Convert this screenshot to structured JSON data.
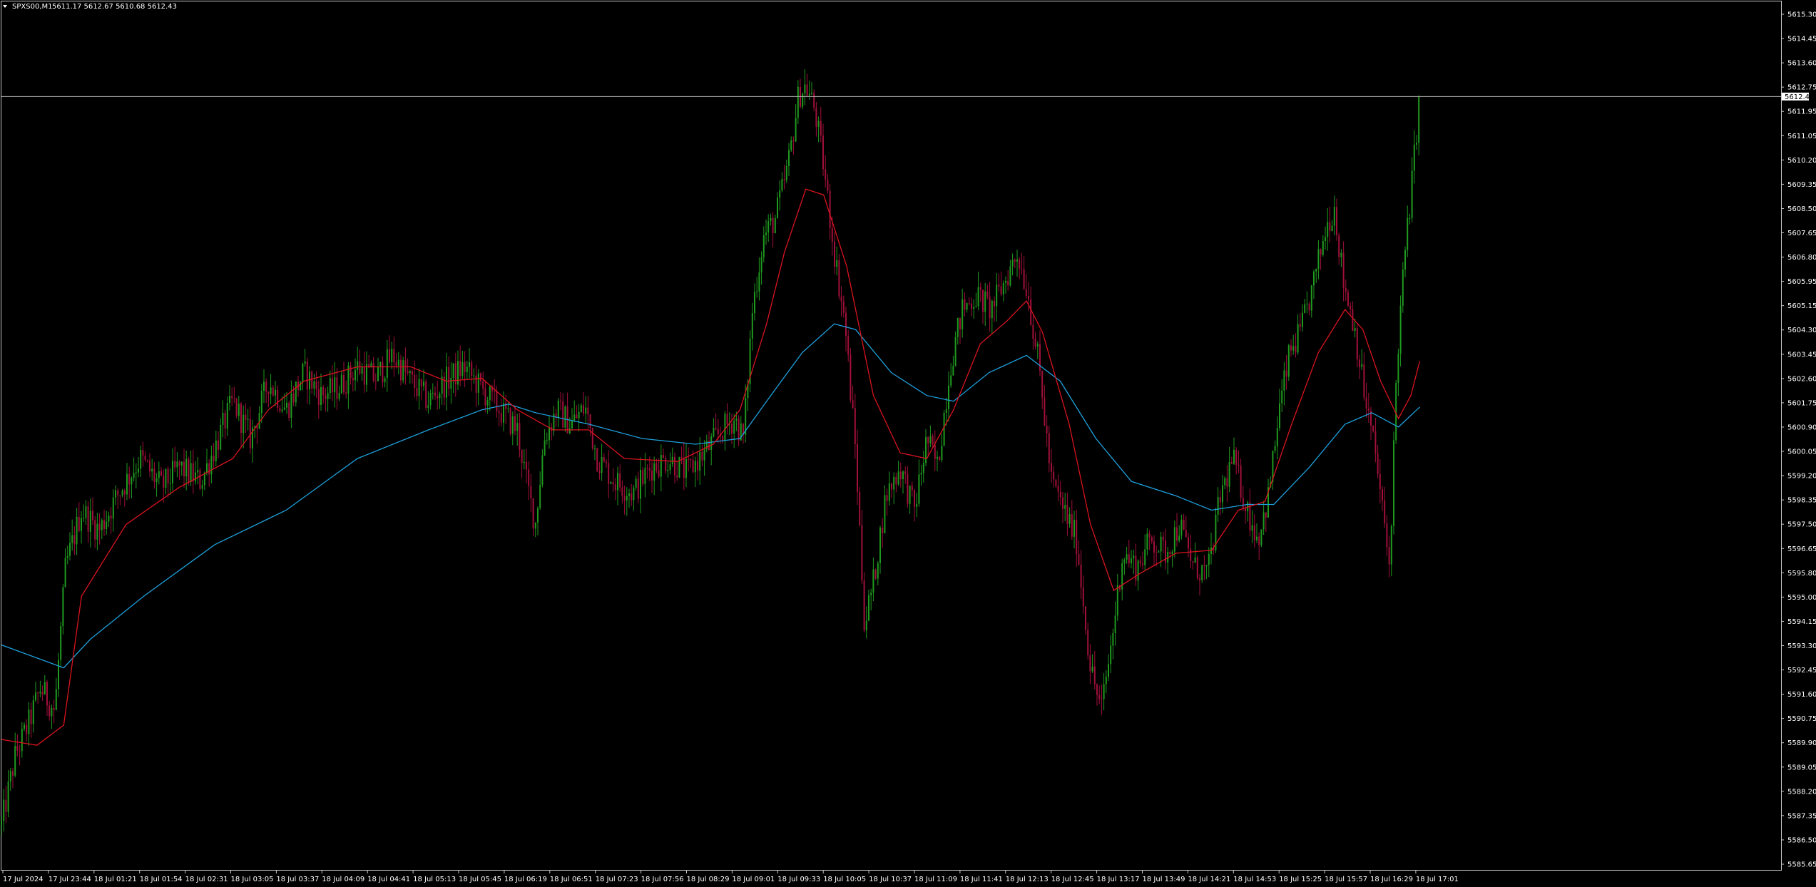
{
  "header": {
    "symbol": "SPXS00,M1",
    "ohlc": "5611.17 5612.67 5610.68 5612.43"
  },
  "price_tag": "5612.43",
  "colors": {
    "background": "#000000",
    "frame": "#c8c8c8",
    "bull": "#1f9a1f",
    "bear": "#a0103a",
    "ma_fast": "#d9141e",
    "ma_slow": "#1ea0dc",
    "last_price_line": "#b4b4b4"
  },
  "chart_data": {
    "type": "candlestick",
    "grid": false,
    "ylim": [
      5585.65,
      5615.3
    ],
    "y_ticks": [
      "5615.30",
      "5614.45",
      "5613.60",
      "5612.75",
      "5611.95",
      "5611.05",
      "5610.20",
      "5609.35",
      "5608.50",
      "5607.65",
      "5606.80",
      "5605.95",
      "5605.15",
      "5604.30",
      "5603.45",
      "5602.60",
      "5601.75",
      "5600.90",
      "5600.05",
      "5599.20",
      "5598.35",
      "5597.50",
      "5596.65",
      "5595.80",
      "5595.00",
      "5594.15",
      "5593.30",
      "5592.45",
      "5591.60",
      "5590.75",
      "5589.90",
      "5589.05",
      "5588.20",
      "5587.35",
      "5586.50",
      "5585.65"
    ],
    "x_ticks": [
      "17 Jul 2024",
      "17 Jul 23:44",
      "18 Jul 01:21",
      "18 Jul 01:54",
      "18 Jul 02:31",
      "18 Jul 03:05",
      "18 Jul 03:37",
      "18 Jul 04:09",
      "18 Jul 04:41",
      "18 Jul 05:13",
      "18 Jul 05:45",
      "18 Jul 06:19",
      "18 Jul 06:51",
      "18 Jul 07:23",
      "18 Jul 07:56",
      "18 Jul 08:29",
      "18 Jul 09:01",
      "18 Jul 09:33",
      "18 Jul 10:05",
      "18 Jul 10:37",
      "18 Jul 11:09",
      "18 Jul 11:41",
      "18 Jul 12:13",
      "18 Jul 12:45",
      "18 Jul 13:17",
      "18 Jul 13:49",
      "18 Jul 14:21",
      "18 Jul 14:53",
      "18 Jul 15:25",
      "18 Jul 15:57",
      "18 Jul 16:29",
      "18 Jul 17:01"
    ],
    "last_price": 5612.43,
    "close_path": [
      [
        0,
        5587.0
      ],
      [
        0.008,
        5589.5
      ],
      [
        0.015,
        5590.5
      ],
      [
        0.022,
        5591.8
      ],
      [
        0.03,
        5591.0
      ],
      [
        0.036,
        5596.0
      ],
      [
        0.045,
        5598.0
      ],
      [
        0.055,
        5597.3
      ],
      [
        0.065,
        5598.5
      ],
      [
        0.078,
        5599.8
      ],
      [
        0.09,
        5598.8
      ],
      [
        0.1,
        5599.5
      ],
      [
        0.112,
        5599.0
      ],
      [
        0.12,
        5600.2
      ],
      [
        0.13,
        5601.8
      ],
      [
        0.14,
        5600.5
      ],
      [
        0.15,
        5602.5
      ],
      [
        0.16,
        5601.5
      ],
      [
        0.17,
        5602.8
      ],
      [
        0.18,
        5602.0
      ],
      [
        0.19,
        5602.3
      ],
      [
        0.2,
        5603.0
      ],
      [
        0.21,
        5602.6
      ],
      [
        0.22,
        5603.4
      ],
      [
        0.23,
        5602.5
      ],
      [
        0.24,
        5601.8
      ],
      [
        0.25,
        5602.5
      ],
      [
        0.26,
        5603.0
      ],
      [
        0.27,
        5602.2
      ],
      [
        0.28,
        5601.5
      ],
      [
        0.29,
        5600.8
      ],
      [
        0.295,
        5599.0
      ],
      [
        0.3,
        5597.5
      ],
      [
        0.305,
        5600.5
      ],
      [
        0.312,
        5601.5
      ],
      [
        0.32,
        5601.0
      ],
      [
        0.328,
        5601.6
      ],
      [
        0.335,
        5599.8
      ],
      [
        0.345,
        5599.0
      ],
      [
        0.355,
        5598.6
      ],
      [
        0.365,
        5599.5
      ],
      [
        0.375,
        5599.8
      ],
      [
        0.385,
        5599.3
      ],
      [
        0.395,
        5600.0
      ],
      [
        0.405,
        5600.8
      ],
      [
        0.412,
        5601.2
      ],
      [
        0.417,
        5600.5
      ],
      [
        0.422,
        5605.0
      ],
      [
        0.428,
        5607.5
      ],
      [
        0.435,
        5608.2
      ],
      [
        0.442,
        5610.0
      ],
      [
        0.448,
        5612.5
      ],
      [
        0.452,
        5612.8
      ],
      [
        0.457,
        5612.0
      ],
      [
        0.462,
        5610.0
      ],
      [
        0.468,
        5607.0
      ],
      [
        0.474,
        5604.5
      ],
      [
        0.48,
        5600.0
      ],
      [
        0.485,
        5594.0
      ],
      [
        0.49,
        5595.5
      ],
      [
        0.497,
        5598.5
      ],
      [
        0.505,
        5599.5
      ],
      [
        0.513,
        5598.0
      ],
      [
        0.52,
        5600.5
      ],
      [
        0.526,
        5599.5
      ],
      [
        0.533,
        5603.0
      ],
      [
        0.54,
        5605.0
      ],
      [
        0.548,
        5605.5
      ],
      [
        0.556,
        5605.0
      ],
      [
        0.564,
        5606.0
      ],
      [
        0.571,
        5607.0
      ],
      [
        0.577,
        5605.5
      ],
      [
        0.583,
        5603.0
      ],
      [
        0.59,
        5599.0
      ],
      [
        0.597,
        5598.0
      ],
      [
        0.604,
        5597.0
      ],
      [
        0.612,
        5592.5
      ],
      [
        0.618,
        5591.0
      ],
      [
        0.624,
        5593.5
      ],
      [
        0.63,
        5596.5
      ],
      [
        0.638,
        5596.0
      ],
      [
        0.646,
        5597.0
      ],
      [
        0.654,
        5596.5
      ],
      [
        0.662,
        5597.5
      ],
      [
        0.67,
        5596.0
      ],
      [
        0.678,
        5595.8
      ],
      [
        0.685,
        5598.5
      ],
      [
        0.692,
        5599.8
      ],
      [
        0.7,
        5598.0
      ],
      [
        0.706,
        5597.0
      ],
      [
        0.712,
        5598.5
      ],
      [
        0.718,
        5601.5
      ],
      [
        0.724,
        5603.5
      ],
      [
        0.73,
        5604.2
      ],
      [
        0.737,
        5605.8
      ],
      [
        0.744,
        5607.8
      ],
      [
        0.749,
        5608.6
      ],
      [
        0.754,
        5606.0
      ],
      [
        0.76,
        5604.5
      ],
      [
        0.766,
        5602.0
      ],
      [
        0.772,
        5600.0
      ],
      [
        0.776,
        5598.0
      ],
      [
        0.78,
        5596.0
      ],
      [
        0.784,
        5603.0
      ],
      [
        0.788,
        5606.5
      ],
      [
        0.792,
        5609.0
      ],
      [
        0.797,
        5612.6
      ]
    ],
    "ma_fast": [
      [
        0,
        5590.0
      ],
      [
        0.02,
        5589.8
      ],
      [
        0.035,
        5590.5
      ],
      [
        0.045,
        5595.0
      ],
      [
        0.07,
        5597.5
      ],
      [
        0.1,
        5598.8
      ],
      [
        0.13,
        5599.8
      ],
      [
        0.15,
        5601.5
      ],
      [
        0.17,
        5602.5
      ],
      [
        0.2,
        5603.0
      ],
      [
        0.23,
        5603.0
      ],
      [
        0.25,
        5602.5
      ],
      [
        0.27,
        5602.6
      ],
      [
        0.29,
        5601.5
      ],
      [
        0.31,
        5600.8
      ],
      [
        0.33,
        5600.8
      ],
      [
        0.35,
        5599.8
      ],
      [
        0.38,
        5599.7
      ],
      [
        0.4,
        5600.3
      ],
      [
        0.415,
        5601.5
      ],
      [
        0.43,
        5604.5
      ],
      [
        0.44,
        5607.0
      ],
      [
        0.452,
        5609.2
      ],
      [
        0.462,
        5609.0
      ],
      [
        0.475,
        5606.5
      ],
      [
        0.49,
        5602.0
      ],
      [
        0.505,
        5600.0
      ],
      [
        0.52,
        5599.8
      ],
      [
        0.535,
        5601.5
      ],
      [
        0.55,
        5603.8
      ],
      [
        0.565,
        5604.6
      ],
      [
        0.576,
        5605.3
      ],
      [
        0.585,
        5604.2
      ],
      [
        0.6,
        5601.0
      ],
      [
        0.612,
        5597.5
      ],
      [
        0.625,
        5595.2
      ],
      [
        0.64,
        5595.8
      ],
      [
        0.66,
        5596.5
      ],
      [
        0.68,
        5596.6
      ],
      [
        0.695,
        5598.0
      ],
      [
        0.71,
        5598.3
      ],
      [
        0.725,
        5601.0
      ],
      [
        0.74,
        5603.5
      ],
      [
        0.755,
        5605.0
      ],
      [
        0.765,
        5604.3
      ],
      [
        0.775,
        5602.5
      ],
      [
        0.785,
        5601.2
      ],
      [
        0.792,
        5602.0
      ],
      [
        0.797,
        5603.2
      ]
    ],
    "ma_slow": [
      [
        0,
        5593.3
      ],
      [
        0.035,
        5592.5
      ],
      [
        0.05,
        5593.5
      ],
      [
        0.08,
        5595.0
      ],
      [
        0.12,
        5596.8
      ],
      [
        0.16,
        5598.0
      ],
      [
        0.2,
        5599.8
      ],
      [
        0.24,
        5600.8
      ],
      [
        0.27,
        5601.5
      ],
      [
        0.285,
        5601.7
      ],
      [
        0.3,
        5601.4
      ],
      [
        0.33,
        5601.0
      ],
      [
        0.36,
        5600.5
      ],
      [
        0.39,
        5600.3
      ],
      [
        0.415,
        5600.5
      ],
      [
        0.43,
        5601.8
      ],
      [
        0.45,
        5603.5
      ],
      [
        0.468,
        5604.5
      ],
      [
        0.48,
        5604.3
      ],
      [
        0.5,
        5602.8
      ],
      [
        0.52,
        5602.0
      ],
      [
        0.535,
        5601.8
      ],
      [
        0.555,
        5602.8
      ],
      [
        0.576,
        5603.4
      ],
      [
        0.595,
        5602.5
      ],
      [
        0.615,
        5600.5
      ],
      [
        0.635,
        5599.0
      ],
      [
        0.66,
        5598.5
      ],
      [
        0.68,
        5598.0
      ],
      [
        0.7,
        5598.2
      ],
      [
        0.715,
        5598.2
      ],
      [
        0.735,
        5599.5
      ],
      [
        0.755,
        5601.0
      ],
      [
        0.77,
        5601.4
      ],
      [
        0.785,
        5600.9
      ],
      [
        0.797,
        5601.6
      ]
    ]
  }
}
